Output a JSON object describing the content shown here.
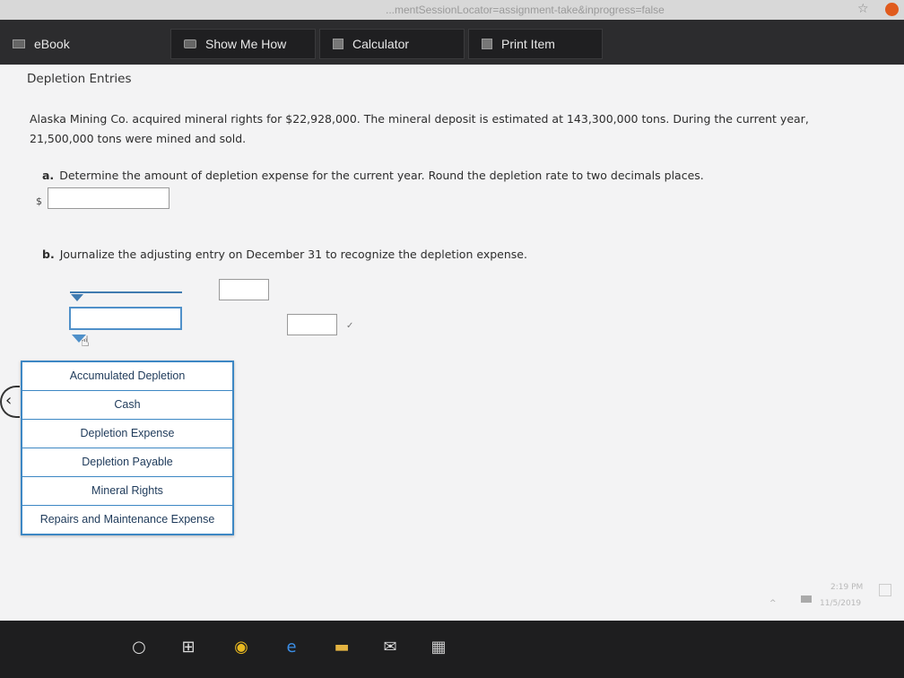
{
  "browser": {
    "url": "...mentSessionLocator=assignment-take&inprogress=false"
  },
  "toolbar": {
    "ebook": "eBook",
    "show_me_how": "Show Me How",
    "calculator": "Calculator",
    "print_item": "Print Item"
  },
  "problem": {
    "title": "Depletion Entries",
    "intro": "Alaska Mining Co. acquired mineral rights for $22,928,000. The mineral deposit is estimated at 143,300,000 tons. During the current year, 21,500,000 tons were mined and sold.",
    "part_a_letter": "a.",
    "part_a": "Determine the amount of depletion expense for the current year. Round the depletion rate to two decimals places.",
    "currency": "$",
    "part_b_letter": "b.",
    "part_b": "Journalize the adjusting entry on December 31 to recognize the depletion expense."
  },
  "dropdown": {
    "options": [
      "Accumulated Depletion",
      "Cash",
      "Depletion Expense",
      "Depletion Payable",
      "Mineral Rights",
      "Repairs and Maintenance Expense"
    ]
  },
  "taskbar": {
    "time": "2:19 PM",
    "date": "11/5/2019"
  }
}
